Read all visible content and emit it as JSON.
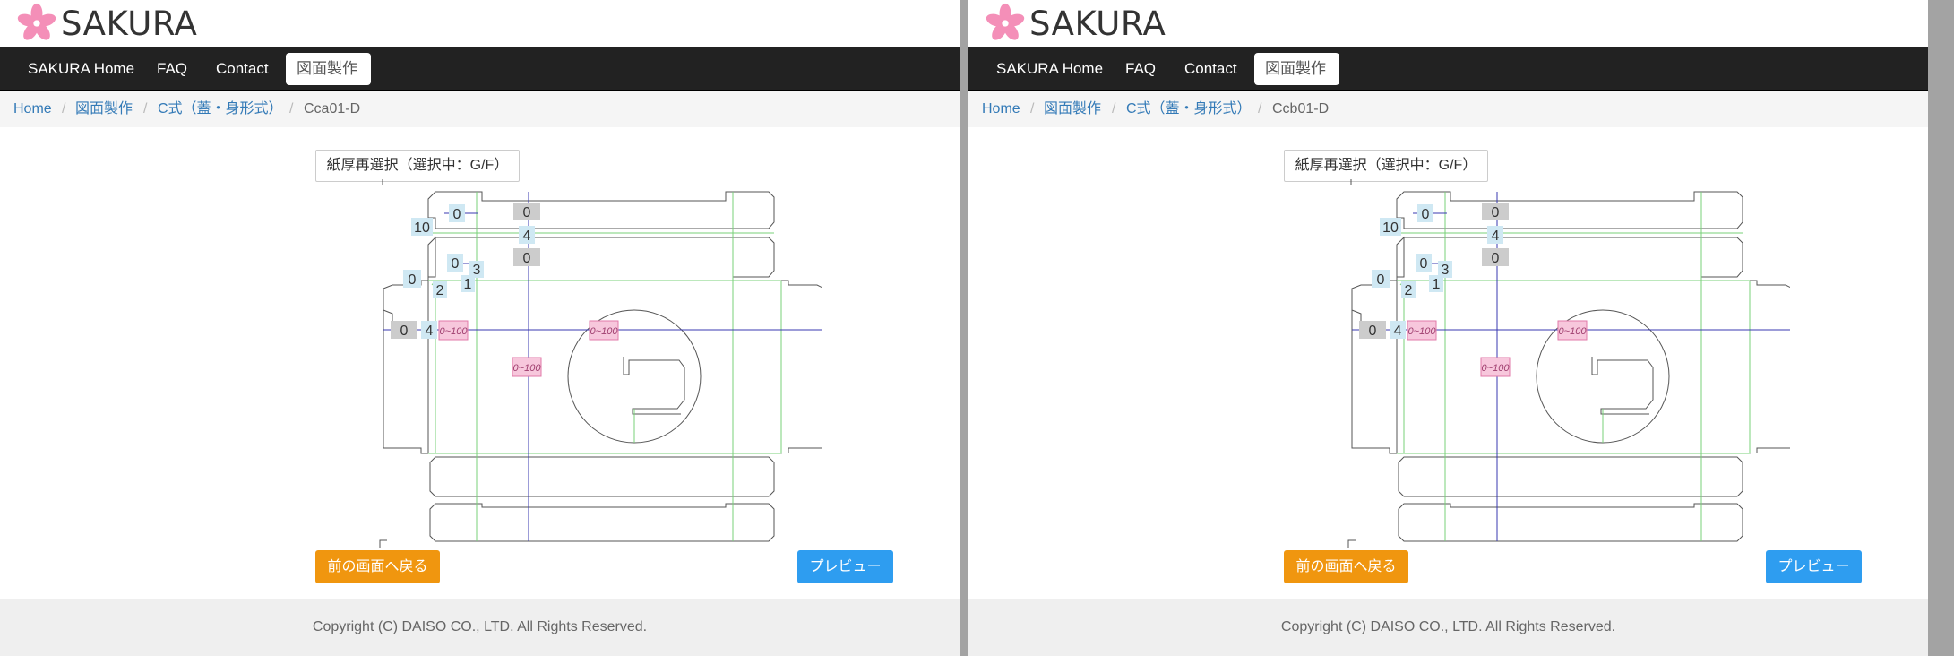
{
  "panels": [
    {
      "site": {
        "logo_text": "SAKURA"
      },
      "nav": {
        "items": [
          "SAKURA Home",
          "FAQ",
          "Contact",
          "図面製作"
        ],
        "active_index": 3
      },
      "breadcrumb": {
        "items": [
          "Home",
          "図面製作",
          "C式（蓋・身形式）",
          "Cca01-D"
        ]
      },
      "reselect_label": "紙厚再選択（選択中：G/F）",
      "diagram": {
        "dim_labels": [
          "0",
          "0",
          "4",
          "0",
          "10",
          "0",
          "3",
          "1",
          "2",
          "0",
          "0",
          "4"
        ],
        "range_labels": [
          "0~100",
          "0~100",
          "0~100"
        ]
      },
      "back_label": "前の画面へ戻る",
      "preview_label": "プレビュー",
      "copyright": "Copyright (C) DAISO CO., LTD. All Rights Reserved."
    },
    {
      "site": {
        "logo_text": "SAKURA"
      },
      "nav": {
        "items": [
          "SAKURA Home",
          "FAQ",
          "Contact",
          "図面製作"
        ],
        "active_index": 3
      },
      "breadcrumb": {
        "items": [
          "Home",
          "図面製作",
          "C式（蓋・身形式）",
          "Ccb01-D"
        ]
      },
      "reselect_label": "紙厚再選択（選択中：G/F）",
      "diagram": {
        "dim_labels": [
          "0",
          "0",
          "4",
          "0",
          "10",
          "0",
          "3",
          "1",
          "2",
          "0",
          "0",
          "4"
        ],
        "range_labels": [
          "0~100",
          "0~100",
          "0~100"
        ]
      },
      "back_label": "前の画面へ戻る",
      "preview_label": "プレビュー",
      "copyright": "Copyright (C) DAISO CO., LTD. All Rights Reserved."
    }
  ],
  "colors": {
    "accent_orange": "#f0960f",
    "accent_blue": "#2e9df0",
    "navbar_bg": "#222222",
    "link": "#337ab7",
    "fold_line": "#78d078",
    "cut_line": "#555555",
    "dim_line": "#3838b0",
    "label_blue_bg": "#cfe8f3",
    "label_gray_bg": "#cccccc",
    "label_pink_bg": "#f7c7dc"
  },
  "icons": {
    "logo": "sakura-flower-icon"
  }
}
